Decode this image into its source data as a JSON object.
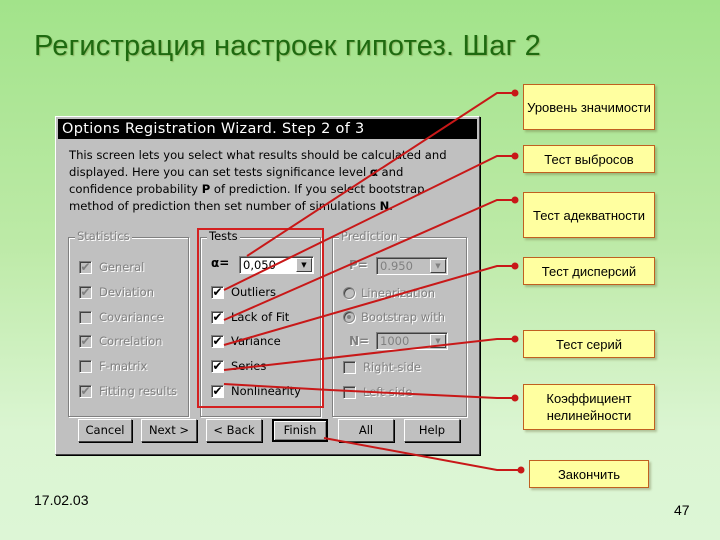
{
  "slide": {
    "title": "Регистрация настроек гипотез. Шаг 2",
    "date": "17.02.03",
    "page_number": "47"
  },
  "dialog": {
    "title": "Options Registration Wizard. Step 2 of 3",
    "intro_parts": {
      "a": "This screen lets you select what results should be calculated and displayed. Here you can set tests significance level ",
      "alpha": "α",
      "b": " and confidence probability ",
      "p": "P",
      "c": " of prediction. If you select bootstrap method of prediction then set number of simulations ",
      "n": "N",
      "d": "."
    },
    "statistics": {
      "label": "Statistics",
      "items": [
        {
          "label": "General",
          "checked": true
        },
        {
          "label": "Deviation",
          "checked": true
        },
        {
          "label": "Covariance",
          "checked": false
        },
        {
          "label": "Correlation",
          "checked": true
        },
        {
          "label": "F-matrix",
          "checked": false
        },
        {
          "label": "Fitting results",
          "checked": true
        }
      ]
    },
    "tests": {
      "label": "Tests",
      "alpha_label": "α=",
      "alpha_value": "0,050",
      "items": [
        {
          "label": "Outliers",
          "checked": true
        },
        {
          "label": "Lack of Fit",
          "checked": true
        },
        {
          "label": "Variance",
          "checked": true
        },
        {
          "label": "Series",
          "checked": true
        },
        {
          "label": "Nonlinearity",
          "checked": true
        }
      ]
    },
    "prediction": {
      "label": "Prediction",
      "p_label": "P=",
      "p_value": "0.950",
      "linearization_label": "Linearization",
      "bootstrap_label": "Bootstrap with",
      "selected_method": "bootstrap",
      "n_label": "N=",
      "n_value": "1000",
      "right_side_label": "Right-side",
      "left_side_label": "Left-side"
    },
    "buttons": {
      "cancel": "Cancel",
      "next": "Next >",
      "back": "< Back",
      "finish": "Finish",
      "all": "All",
      "help": "Help"
    },
    "checkmark": "✔",
    "dropdown_arrow": "▼"
  },
  "callouts": [
    {
      "text": "Уровень значимости",
      "target": "alpha-combo"
    },
    {
      "text": "Тест выбросов",
      "target": "outliers-checkbox"
    },
    {
      "text": "Тест адекватности",
      "target": "lack-of-fit-checkbox"
    },
    {
      "text": "Тест дисперсий",
      "target": "variance-checkbox"
    },
    {
      "text": "Тест серий",
      "target": "series-checkbox"
    },
    {
      "text": "Коэффициент нелинейности",
      "target": "nonlinearity-checkbox"
    },
    {
      "text": "Закончить",
      "target": "finish-button"
    }
  ],
  "colors": {
    "title_green": "#1e6a10",
    "highlight_red": "#d42020",
    "callout_fill": "#ffffa0",
    "dialog_gray": "#c0c0c0"
  }
}
